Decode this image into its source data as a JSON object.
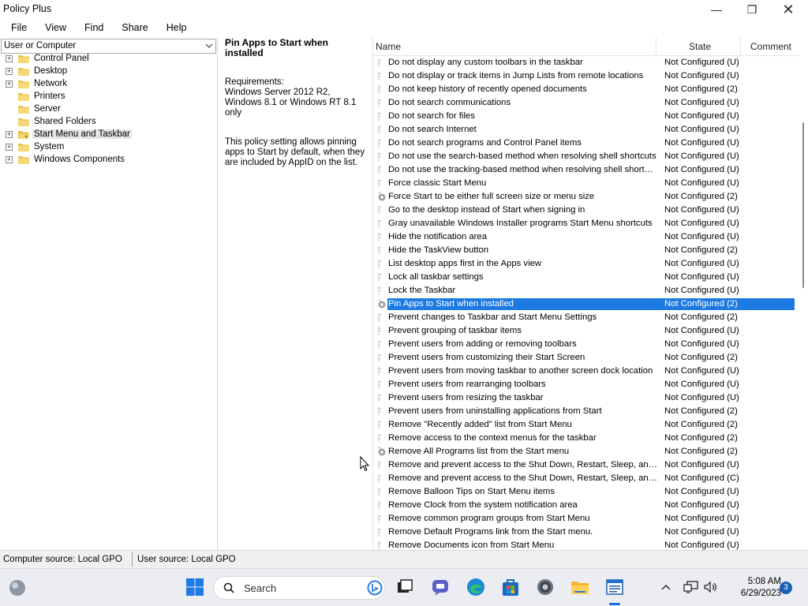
{
  "window": {
    "title": "Policy Plus",
    "min_glyph": "—",
    "max_glyph": "❐",
    "close_glyph": "✕"
  },
  "menu": [
    "File",
    "View",
    "Find",
    "Share",
    "Help"
  ],
  "left_pane": {
    "scope_selector": "User or Computer",
    "tree": [
      {
        "label": "Control Panel",
        "expandable": true
      },
      {
        "label": "Desktop",
        "expandable": true
      },
      {
        "label": "Network",
        "expandable": true
      },
      {
        "label": "Printers",
        "expandable": false
      },
      {
        "label": "Server",
        "expandable": false
      },
      {
        "label": "Shared Folders",
        "expandable": false
      },
      {
        "label": "Start Menu and Taskbar",
        "expandable": true,
        "selected": true
      },
      {
        "label": "System",
        "expandable": true
      },
      {
        "label": "Windows Components",
        "expandable": true
      }
    ]
  },
  "description": {
    "title": "Pin Apps to Start when installed",
    "requirements": "Requirements:\nWindows Server 2012 R2, Windows 8.1 or Windows RT 8.1 only",
    "text": "This policy setting allows pinning apps to Start by default, when they are included by AppID on the list."
  },
  "list": {
    "columns": {
      "name": "Name",
      "state": "State",
      "comment": "Comment"
    },
    "rows": [
      {
        "name": "Do not display any custom toolbars in the taskbar",
        "state": "Not Configured (U)"
      },
      {
        "name": "Do not display or track items in Jump Lists from remote locations",
        "state": "Not Configured (U)"
      },
      {
        "name": "Do not keep history of recently opened documents",
        "state": "Not Configured (2)"
      },
      {
        "name": "Do not search communications",
        "state": "Not Configured (U)"
      },
      {
        "name": "Do not search for files",
        "state": "Not Configured (U)"
      },
      {
        "name": "Do not search Internet",
        "state": "Not Configured (U)"
      },
      {
        "name": "Do not search programs and Control Panel items",
        "state": "Not Configured (U)"
      },
      {
        "name": "Do not use the search-based method when resolving shell shortcuts",
        "state": "Not Configured (U)"
      },
      {
        "name": "Do not use the tracking-based method when resolving shell shortcuts",
        "state": "Not Configured (U)"
      },
      {
        "name": "Force classic Start Menu",
        "state": "Not Configured (U)"
      },
      {
        "name": "Force Start to be either full screen size or menu size",
        "state": "Not Configured (2)",
        "gear": true
      },
      {
        "name": "Go to the desktop instead of Start when signing in",
        "state": "Not Configured (U)"
      },
      {
        "name": "Gray unavailable Windows Installer programs Start Menu shortcuts",
        "state": "Not Configured (U)"
      },
      {
        "name": "Hide the notification area",
        "state": "Not Configured (U)"
      },
      {
        "name": "Hide the TaskView button",
        "state": "Not Configured (2)"
      },
      {
        "name": "List desktop apps first in the Apps view",
        "state": "Not Configured (U)"
      },
      {
        "name": "Lock all taskbar settings",
        "state": "Not Configured (U)"
      },
      {
        "name": "Lock the Taskbar",
        "state": "Not Configured (U)"
      },
      {
        "name": "Pin Apps to Start when installed",
        "state": "Not Configured (2)",
        "gear": true,
        "selected": true
      },
      {
        "name": "Prevent changes to Taskbar and Start Menu Settings",
        "state": "Not Configured (2)"
      },
      {
        "name": "Prevent grouping of taskbar items",
        "state": "Not Configured (U)"
      },
      {
        "name": "Prevent users from adding or removing toolbars",
        "state": "Not Configured (U)"
      },
      {
        "name": "Prevent users from customizing their Start Screen",
        "state": "Not Configured (2)"
      },
      {
        "name": "Prevent users from moving taskbar to another screen dock location",
        "state": "Not Configured (U)"
      },
      {
        "name": "Prevent users from rearranging toolbars",
        "state": "Not Configured (U)"
      },
      {
        "name": "Prevent users from resizing the taskbar",
        "state": "Not Configured (U)"
      },
      {
        "name": "Prevent users from uninstalling applications from Start",
        "state": "Not Configured (2)"
      },
      {
        "name": "Remove \"Recently added\" list from Start Menu",
        "state": "Not Configured (2)"
      },
      {
        "name": "Remove access to the context menus for the taskbar",
        "state": "Not Configured (2)"
      },
      {
        "name": "Remove All Programs list from the Start menu",
        "state": "Not Configured (2)",
        "gear": true
      },
      {
        "name": "Remove and prevent access to the Shut Down, Restart, Sleep, and ...",
        "state": "Not Configured (U)"
      },
      {
        "name": "Remove and prevent access to the Shut Down, Restart, Sleep, and ...",
        "state": "Not Configured (C)"
      },
      {
        "name": "Remove Balloon Tips on Start Menu items",
        "state": "Not Configured (U)"
      },
      {
        "name": "Remove Clock from the system notification area",
        "state": "Not Configured (U)"
      },
      {
        "name": "Remove common program groups from Start Menu",
        "state": "Not Configured (U)"
      },
      {
        "name": "Remove Default Programs link from the Start menu.",
        "state": "Not Configured (U)"
      },
      {
        "name": "Remove Documents icon from Start Menu",
        "state": "Not Configured (U)"
      }
    ]
  },
  "status_bar": {
    "computer_source": "Computer source:  Local GPO",
    "user_source": "User source:  Local GPO"
  },
  "taskbar": {
    "search_placeholder": "Search",
    "time": "5:08 AM",
    "date": "6/29/2023",
    "notification_count": "3"
  },
  "colors": {
    "selection": "#1e7ae3",
    "folder": "#e8c04a",
    "taskbar_bg": "#ecedf2",
    "statusbar_bg": "#f0f0f0"
  }
}
